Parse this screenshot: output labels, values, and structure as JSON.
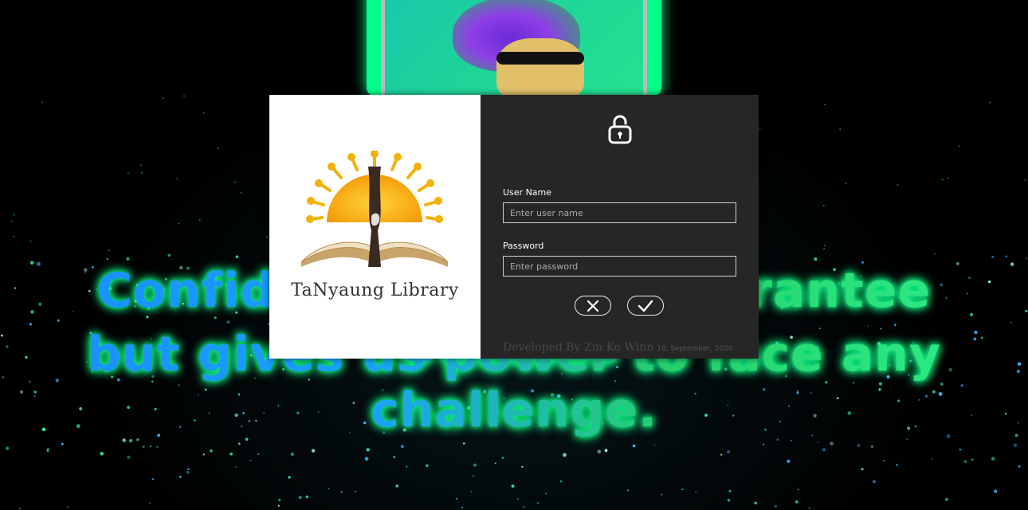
{
  "background": {
    "quote_lines": [
      "Confidence doesn't guarantee success",
      "but gives us power to face any",
      "challenge."
    ]
  },
  "logo_panel": {
    "library_name": "TaNyaung Library",
    "logo_icon": "sun-book-hand-logo"
  },
  "login_form": {
    "lock_icon": "unlock-icon",
    "username_label": "User Name",
    "username_placeholder": "Enter user name",
    "username_value": "",
    "password_label": "Password",
    "password_placeholder": "Enter password",
    "password_value": "",
    "cancel_icon": "close-icon",
    "ok_icon": "check-icon",
    "credit_developer": "Developed By Zin Ko Winn",
    "credit_date": "10, September, 2020"
  },
  "colors": {
    "form_bg": "#262626",
    "logo_bg": "#ffffff",
    "glow_blue": "#1a8cff",
    "glow_green": "#2ef08a"
  }
}
